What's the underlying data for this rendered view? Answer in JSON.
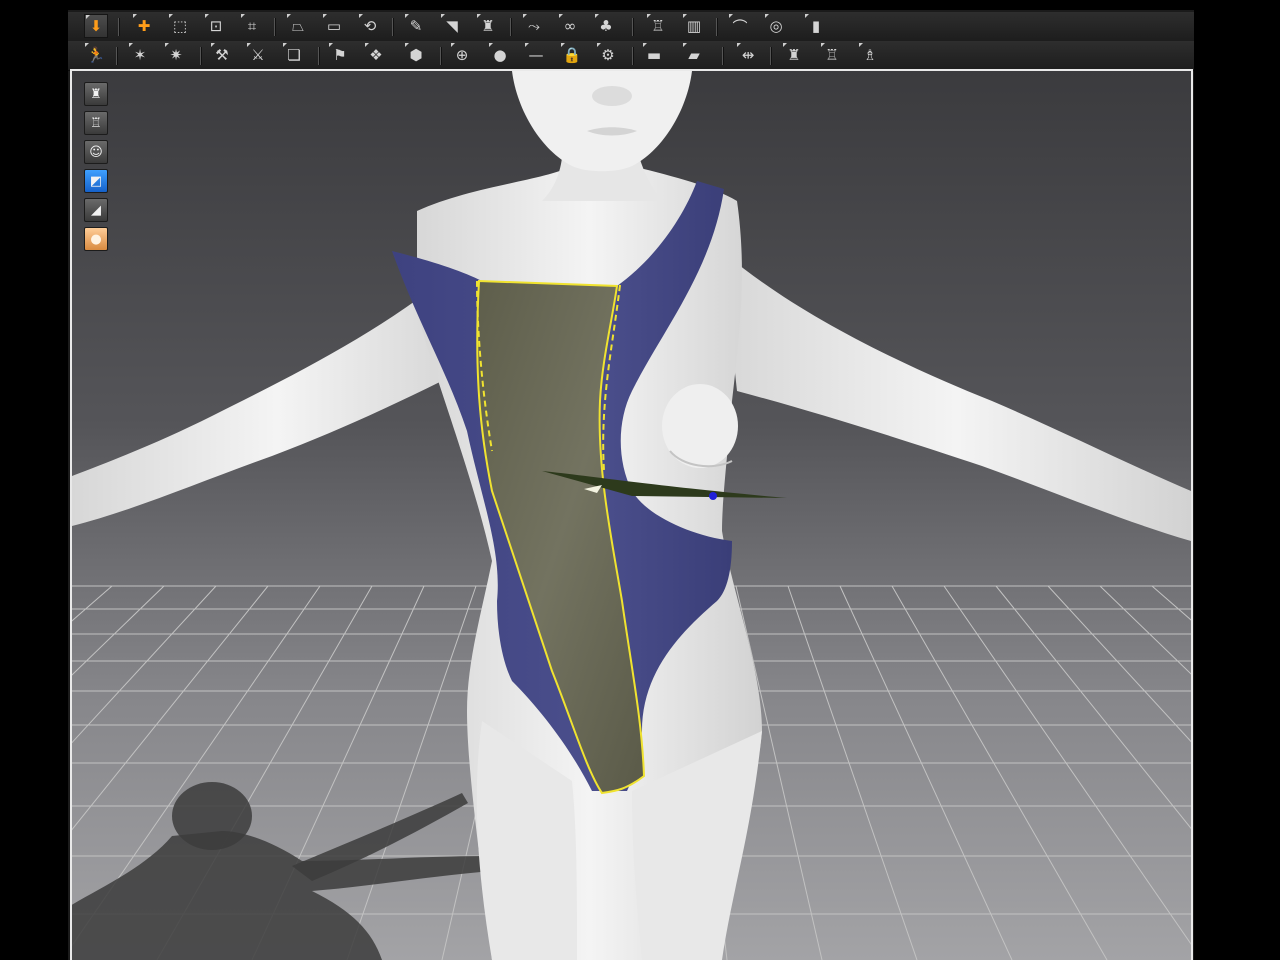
{
  "toolbar_row_1": {
    "tools": [
      {
        "name": "simulate-button",
        "icon": "arrow-down-icon",
        "glyph": "⬇",
        "accent": true,
        "active": true
      },
      {
        "name": "transform-pattern-button",
        "icon": "move-plus-icon",
        "glyph": "✚",
        "accent": true
      },
      {
        "name": "transform-select-button",
        "icon": "dashed-square-icon",
        "glyph": "⬚"
      },
      {
        "name": "edit-points-button",
        "icon": "point-edit-icon",
        "glyph": "⊡"
      },
      {
        "name": "edit-curve-button",
        "icon": "curve-edit-icon",
        "glyph": "⌗"
      },
      {
        "name": "polygon-tool-button",
        "icon": "polygon-icon",
        "glyph": "⏢"
      },
      {
        "name": "rectangle-tool-button",
        "icon": "rectangle-icon",
        "glyph": "▭"
      },
      {
        "name": "circle-tool-button",
        "icon": "circle-icon",
        "glyph": "⟲"
      },
      {
        "name": "internal-line-button",
        "icon": "pen-icon",
        "glyph": "✎"
      },
      {
        "name": "dart-tool-button",
        "icon": "dart-icon",
        "glyph": "◥"
      },
      {
        "name": "trace-tool-button",
        "icon": "garment-icon",
        "glyph": "♜"
      },
      {
        "name": "segment-sewing-button",
        "icon": "sewing-segment-icon",
        "glyph": "⤳"
      },
      {
        "name": "free-sewing-button",
        "icon": "sewing-free-icon",
        "glyph": "∞"
      },
      {
        "name": "check-sewing-button",
        "icon": "sewing-check-icon",
        "glyph": "♣"
      },
      {
        "name": "fold-arrangement-button",
        "icon": "shirt-fold-icon",
        "glyph": "♖"
      },
      {
        "name": "tack-button",
        "icon": "tack-icon",
        "glyph": "▥"
      },
      {
        "name": "measure-button",
        "icon": "tape-icon",
        "glyph": "⌒"
      },
      {
        "name": "circumference-button",
        "icon": "ring-icon",
        "glyph": "◎"
      },
      {
        "name": "ruler-button",
        "icon": "ruler-icon",
        "glyph": "▮"
      }
    ]
  },
  "toolbar_row_2": {
    "tools": [
      {
        "name": "avatar-pose-button",
        "icon": "running-figure-icon",
        "glyph": "🏃"
      },
      {
        "name": "pin-button",
        "icon": "pin-icon",
        "glyph": "✶"
      },
      {
        "name": "pin-box-button",
        "icon": "pin-box-icon",
        "glyph": "✷"
      },
      {
        "name": "strengthen-button",
        "icon": "strengthen-icon",
        "glyph": "⚒"
      },
      {
        "name": "shrink-button",
        "icon": "shrink-icon",
        "glyph": "⚔"
      },
      {
        "name": "edit-texture-button",
        "icon": "texture-icon",
        "glyph": "❏"
      },
      {
        "name": "graphic-button",
        "icon": "graphic-icon",
        "glyph": "⚑"
      },
      {
        "name": "puckering-button",
        "icon": "pucker-icon",
        "glyph": "❖"
      },
      {
        "name": "topstitch-button",
        "icon": "stitch-icon",
        "glyph": "⬢"
      },
      {
        "name": "button-tool-button",
        "icon": "button-icon",
        "glyph": "⊕"
      },
      {
        "name": "buttonhole-button",
        "icon": "buttonhole-icon",
        "glyph": "●"
      },
      {
        "name": "fasten-button",
        "icon": "fasten-icon",
        "glyph": "—"
      },
      {
        "name": "zipper-lock-button",
        "icon": "lock-icon",
        "glyph": "🔒"
      },
      {
        "name": "zipper-button",
        "icon": "zipper-icon",
        "glyph": "⚙"
      },
      {
        "name": "bind-button",
        "icon": "flag-icon",
        "glyph": "▬"
      },
      {
        "name": "tape-button",
        "icon": "tape-strip-icon",
        "glyph": "▰"
      },
      {
        "name": "align-button",
        "icon": "align-icon",
        "glyph": "⇹"
      },
      {
        "name": "fold-button",
        "icon": "shirt-icon",
        "glyph": "♜"
      },
      {
        "name": "layer-button",
        "icon": "layer-shirt-icon",
        "glyph": "♖"
      },
      {
        "name": "skin-offset-button",
        "icon": "shirt-wide-icon",
        "glyph": "♗"
      }
    ]
  },
  "side_toolbar": [
    {
      "name": "show-garment-button",
      "icon": "tshirt-icon",
      "glyph": "♜",
      "style": "grey"
    },
    {
      "name": "show-garment-wire-button",
      "icon": "tshirt-outline-icon",
      "glyph": "♖",
      "style": "grey"
    },
    {
      "name": "show-avatar-button",
      "icon": "avatar-bust-icon",
      "glyph": "☺",
      "style": "grey"
    },
    {
      "name": "show-texture-button",
      "icon": "blue-texture-icon",
      "glyph": "◩",
      "style": "blue"
    },
    {
      "name": "show-mesh-button",
      "icon": "mesh-icon",
      "glyph": "◢",
      "style": "grey"
    },
    {
      "name": "avatar-display-button",
      "icon": "skin-avatar-icon",
      "glyph": "●",
      "style": "skin"
    }
  ],
  "scene": {
    "colors": {
      "skin": "#ececec",
      "garment_blue": "#474b87",
      "panel_olive": "#6a6a55",
      "selection_yellow": "#f0e330",
      "grid_line": "#c2c2c2",
      "shadow": "#3c3c3c",
      "gizmo_point": "#2020d8"
    }
  }
}
